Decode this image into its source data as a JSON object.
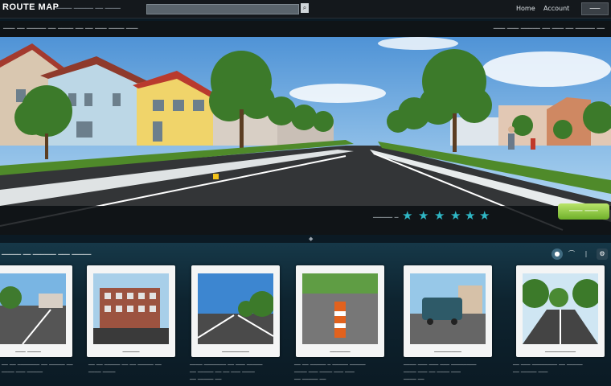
{
  "header": {
    "logo": "ROUTE MAP",
    "nav_text": "──── ───── ── ────",
    "links": [
      "Home",
      "Account"
    ],
    "menu_button": "───"
  },
  "breadcrumb": {
    "left": "─── ── ───── ── ──── ── ── ─── ──── ───",
    "right": "─── ─── ───── ── ─── ── ───── ──"
  },
  "viewer": {
    "control_label": "───── ─",
    "go_button": "─── ───"
  },
  "gallery": {
    "title": "───── ── ────── ─── ─────",
    "cards": [
      {
        "label": "─── ────",
        "desc": [
          "── ── ─────── ── ───── ──",
          "──── ─── ─────"
        ]
      },
      {
        "label": "─────",
        "desc": [
          "── ── ───── ── ── ───── ──",
          "──── ────"
        ]
      },
      {
        "label": "────────",
        "desc": [
          "──── ─────── ── ─── ─────",
          "── ───── ── ── ─── ────",
          "── ───── ──"
        ]
      },
      {
        "label": "──────",
        "desc": [
          "── ── ───── ─ ───── ─────",
          "──── ─── ──── ─── ───",
          "── ───── ──"
        ]
      },
      {
        "label": "────────",
        "desc": [
          "──── ─── ─── ─── ────────",
          "──── ─── ── ──── ───",
          "──── ──"
        ]
      },
      {
        "label": "─────────",
        "desc": [
          "── ─── ──────── ── ─────",
          "── ───── ───"
        ]
      }
    ]
  }
}
